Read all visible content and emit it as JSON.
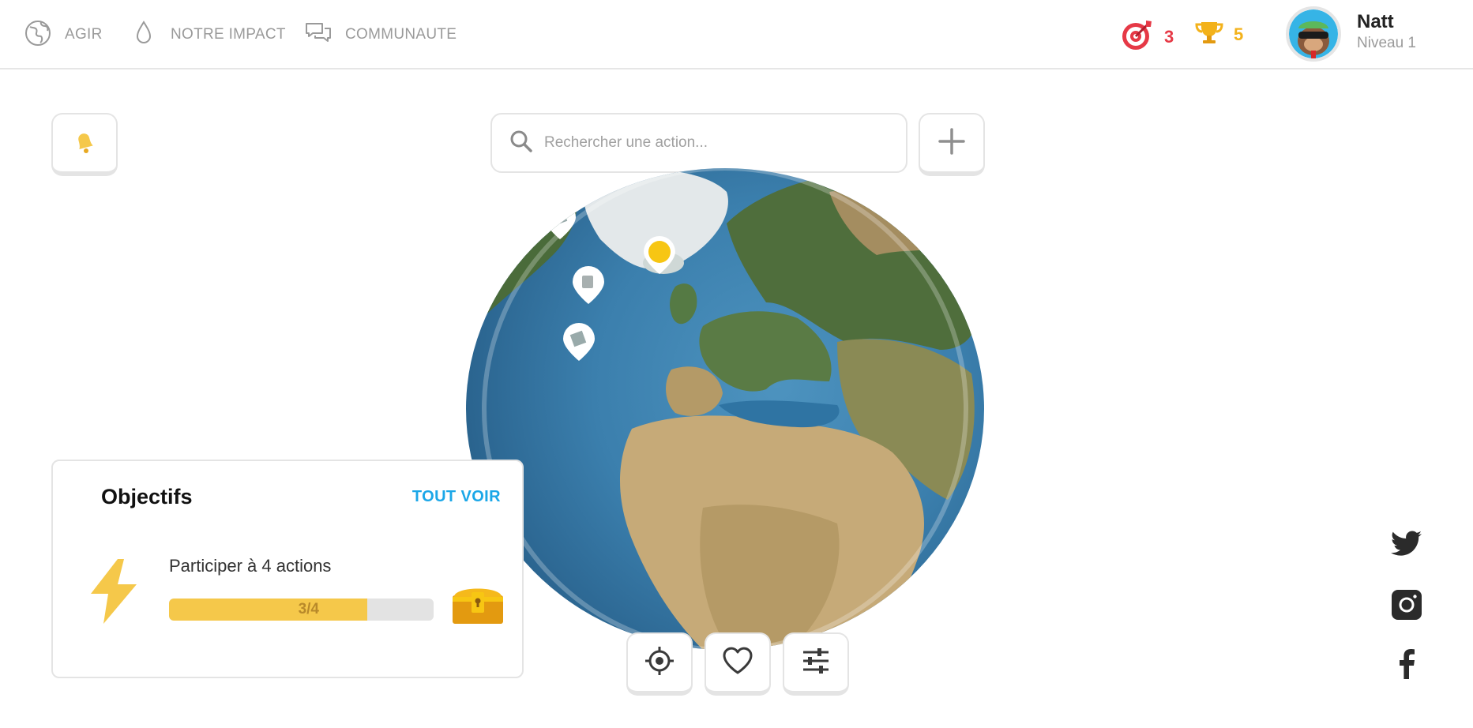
{
  "nav": {
    "agir": "AGIR",
    "impact": "NOTRE IMPACT",
    "communaute": "COMMUNAUTE"
  },
  "stats": {
    "targets": "3",
    "trophies": "5"
  },
  "colors": {
    "accent_blue": "#1ba7e8",
    "target_red": "#e63946",
    "trophy_gold": "#f3b21b",
    "progress_fill": "#f5c84a"
  },
  "user": {
    "name": "Natt",
    "level": "Niveau 1"
  },
  "search": {
    "placeholder": "Rechercher une action..."
  },
  "objectives": {
    "title": "Objectifs",
    "see_all": "TOUT VOIR",
    "item": {
      "label": "Participer à 4 actions",
      "progress_text": "3/4",
      "progress": 0.75
    }
  },
  "icons": {
    "nav": [
      "globe-icon",
      "drop-icon",
      "chat-bubbles-icon"
    ],
    "toolbar": [
      "crosshair-icon",
      "heart-icon",
      "sliders-icon"
    ],
    "social": [
      "twitter-icon",
      "instagram-icon",
      "facebook-icon"
    ]
  }
}
